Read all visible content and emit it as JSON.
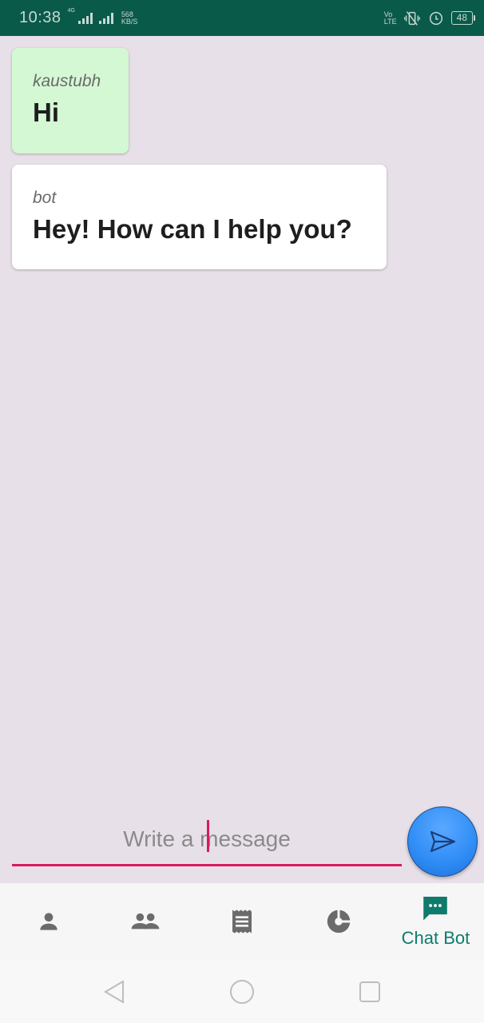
{
  "status_bar": {
    "time": "10:38",
    "network_type": "4G",
    "speed_value": "568",
    "speed_unit": "KB/S",
    "volte_top": "Vo",
    "volte_bottom": "LTE",
    "battery_level": "48"
  },
  "messages": [
    {
      "sender": "kaustubh",
      "text": "Hi",
      "role": "user"
    },
    {
      "sender": "bot",
      "text": "Hey! How can I help you?",
      "role": "bot"
    }
  ],
  "composer": {
    "placeholder": "Write a message"
  },
  "bottom_nav": {
    "items": [
      {
        "icon": "person-icon",
        "label": ""
      },
      {
        "icon": "group-icon",
        "label": ""
      },
      {
        "icon": "receipt-icon",
        "label": ""
      },
      {
        "icon": "pie-chart-icon",
        "label": ""
      },
      {
        "icon": "chat-icon",
        "label": "Chat Bot",
        "active": true
      }
    ]
  },
  "colors": {
    "status_bar": "#0a5a4a",
    "background": "#e8e0e8",
    "user_bubble": "#d4f8d4",
    "bot_bubble": "#ffffff",
    "accent_underline": "#d81b60",
    "active_nav": "#0f7b6c",
    "send_button": "#2f8cf5"
  }
}
